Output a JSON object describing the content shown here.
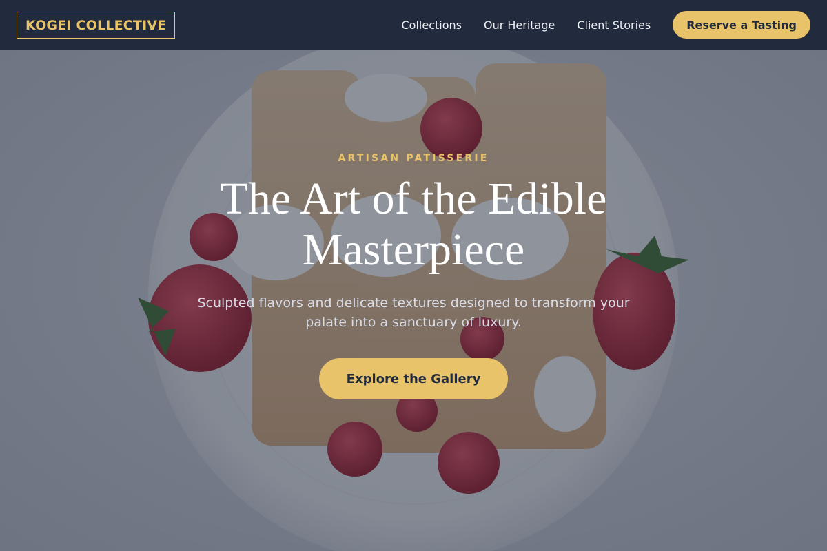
{
  "header": {
    "logo": "KOGEI COLLECTIVE",
    "nav": [
      {
        "label": "Collections"
      },
      {
        "label": "Our Heritage"
      },
      {
        "label": "Client Stories"
      }
    ],
    "cta_label": "Reserve a Tasting"
  },
  "hero": {
    "eyebrow": "ARTISAN PATISSERIE",
    "headline": "The Art of the Edible Masterpiece",
    "subhead": "Sculpted flavors and delicate textures designed to transform your palate into a sanctuary of luxury.",
    "button_label": "Explore the Gallery",
    "background_image": "crepes-with-strawberries-raspberries-and-cream-photo"
  },
  "colors": {
    "header_bg": "#222b3e",
    "accent": "#e8c36a",
    "text_light": "#ffffff"
  }
}
